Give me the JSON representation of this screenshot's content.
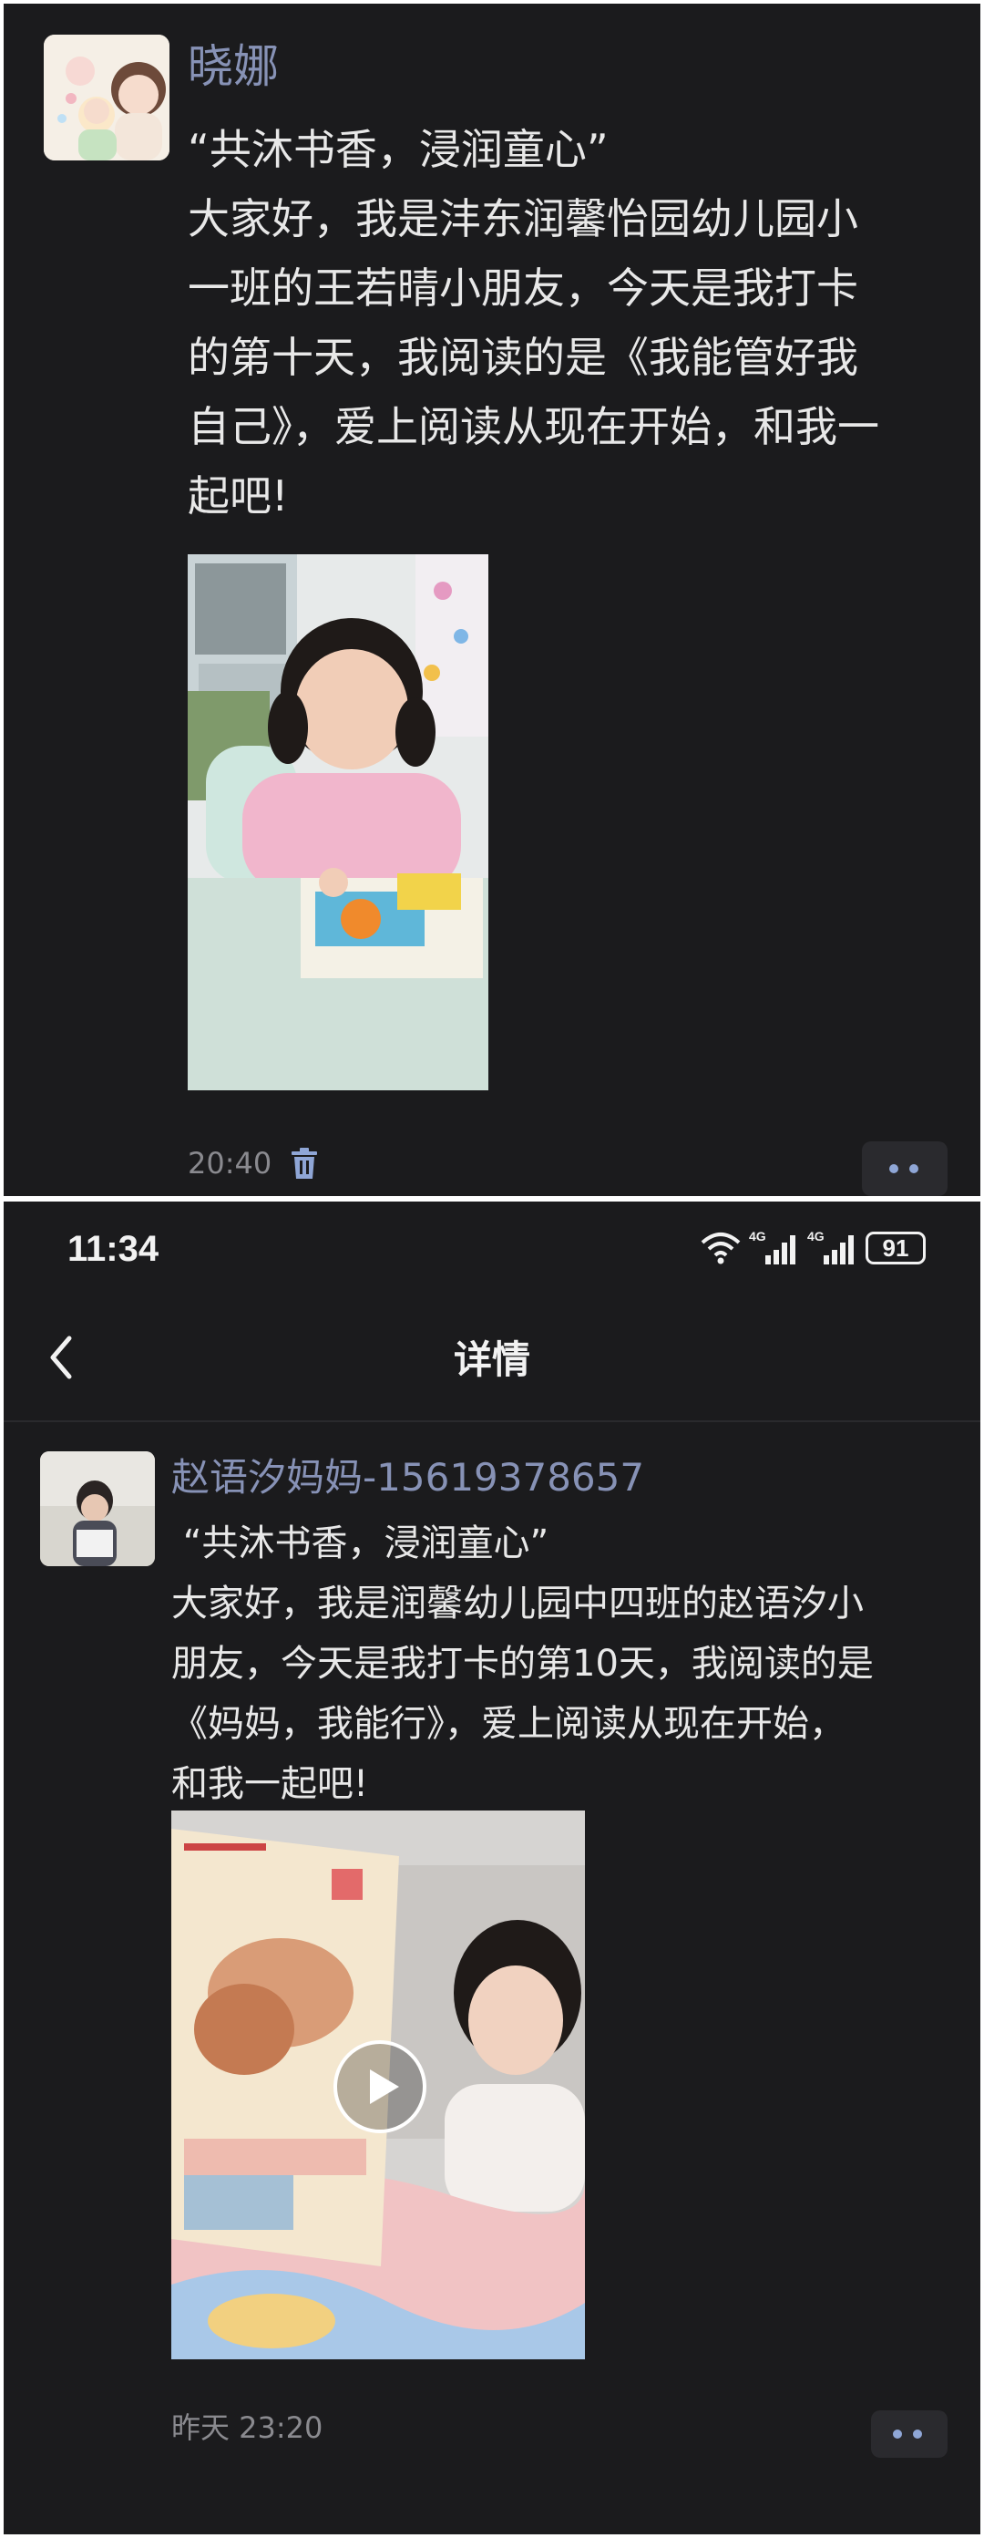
{
  "post1": {
    "author": "晓娜",
    "text": "“共沐书香，浸润童心”\n大家好，我是沣东润馨怡园幼儿园小\n一班的王若晴小朋友，今天是我打卡\n的第十天，我阅读的是《我能管好我\n自己》，爱上阅读从现在开始，和我一\n起吧!",
    "time": "20:40",
    "icons": {
      "delete": "trash-icon",
      "more": "more-dots-icon"
    }
  },
  "status_bar": {
    "time": "11:34",
    "network1": "4G",
    "network2": "4G",
    "battery": "91"
  },
  "header": {
    "title": "详情",
    "back_icon": "chevron-left-icon"
  },
  "post2": {
    "author": "赵语汐妈妈-15619378657",
    "text": " “共沐书香，浸润童心”\n大家好，我是润馨幼儿园中四班的赵语汐小\n朋友，今天是我打卡的第10天，我阅读的是\n《妈妈，我能行》，爱上阅读从现在开始，\n和我一起吧!",
    "time": "昨天 23:20",
    "icons": {
      "play": "play-icon",
      "more": "more-dots-icon"
    }
  },
  "colors": {
    "background": "#1b1b1d",
    "name": "#8792b6",
    "text": "#e8e8e8",
    "muted": "#8a8a8f",
    "dots": "#8fa6d6"
  }
}
